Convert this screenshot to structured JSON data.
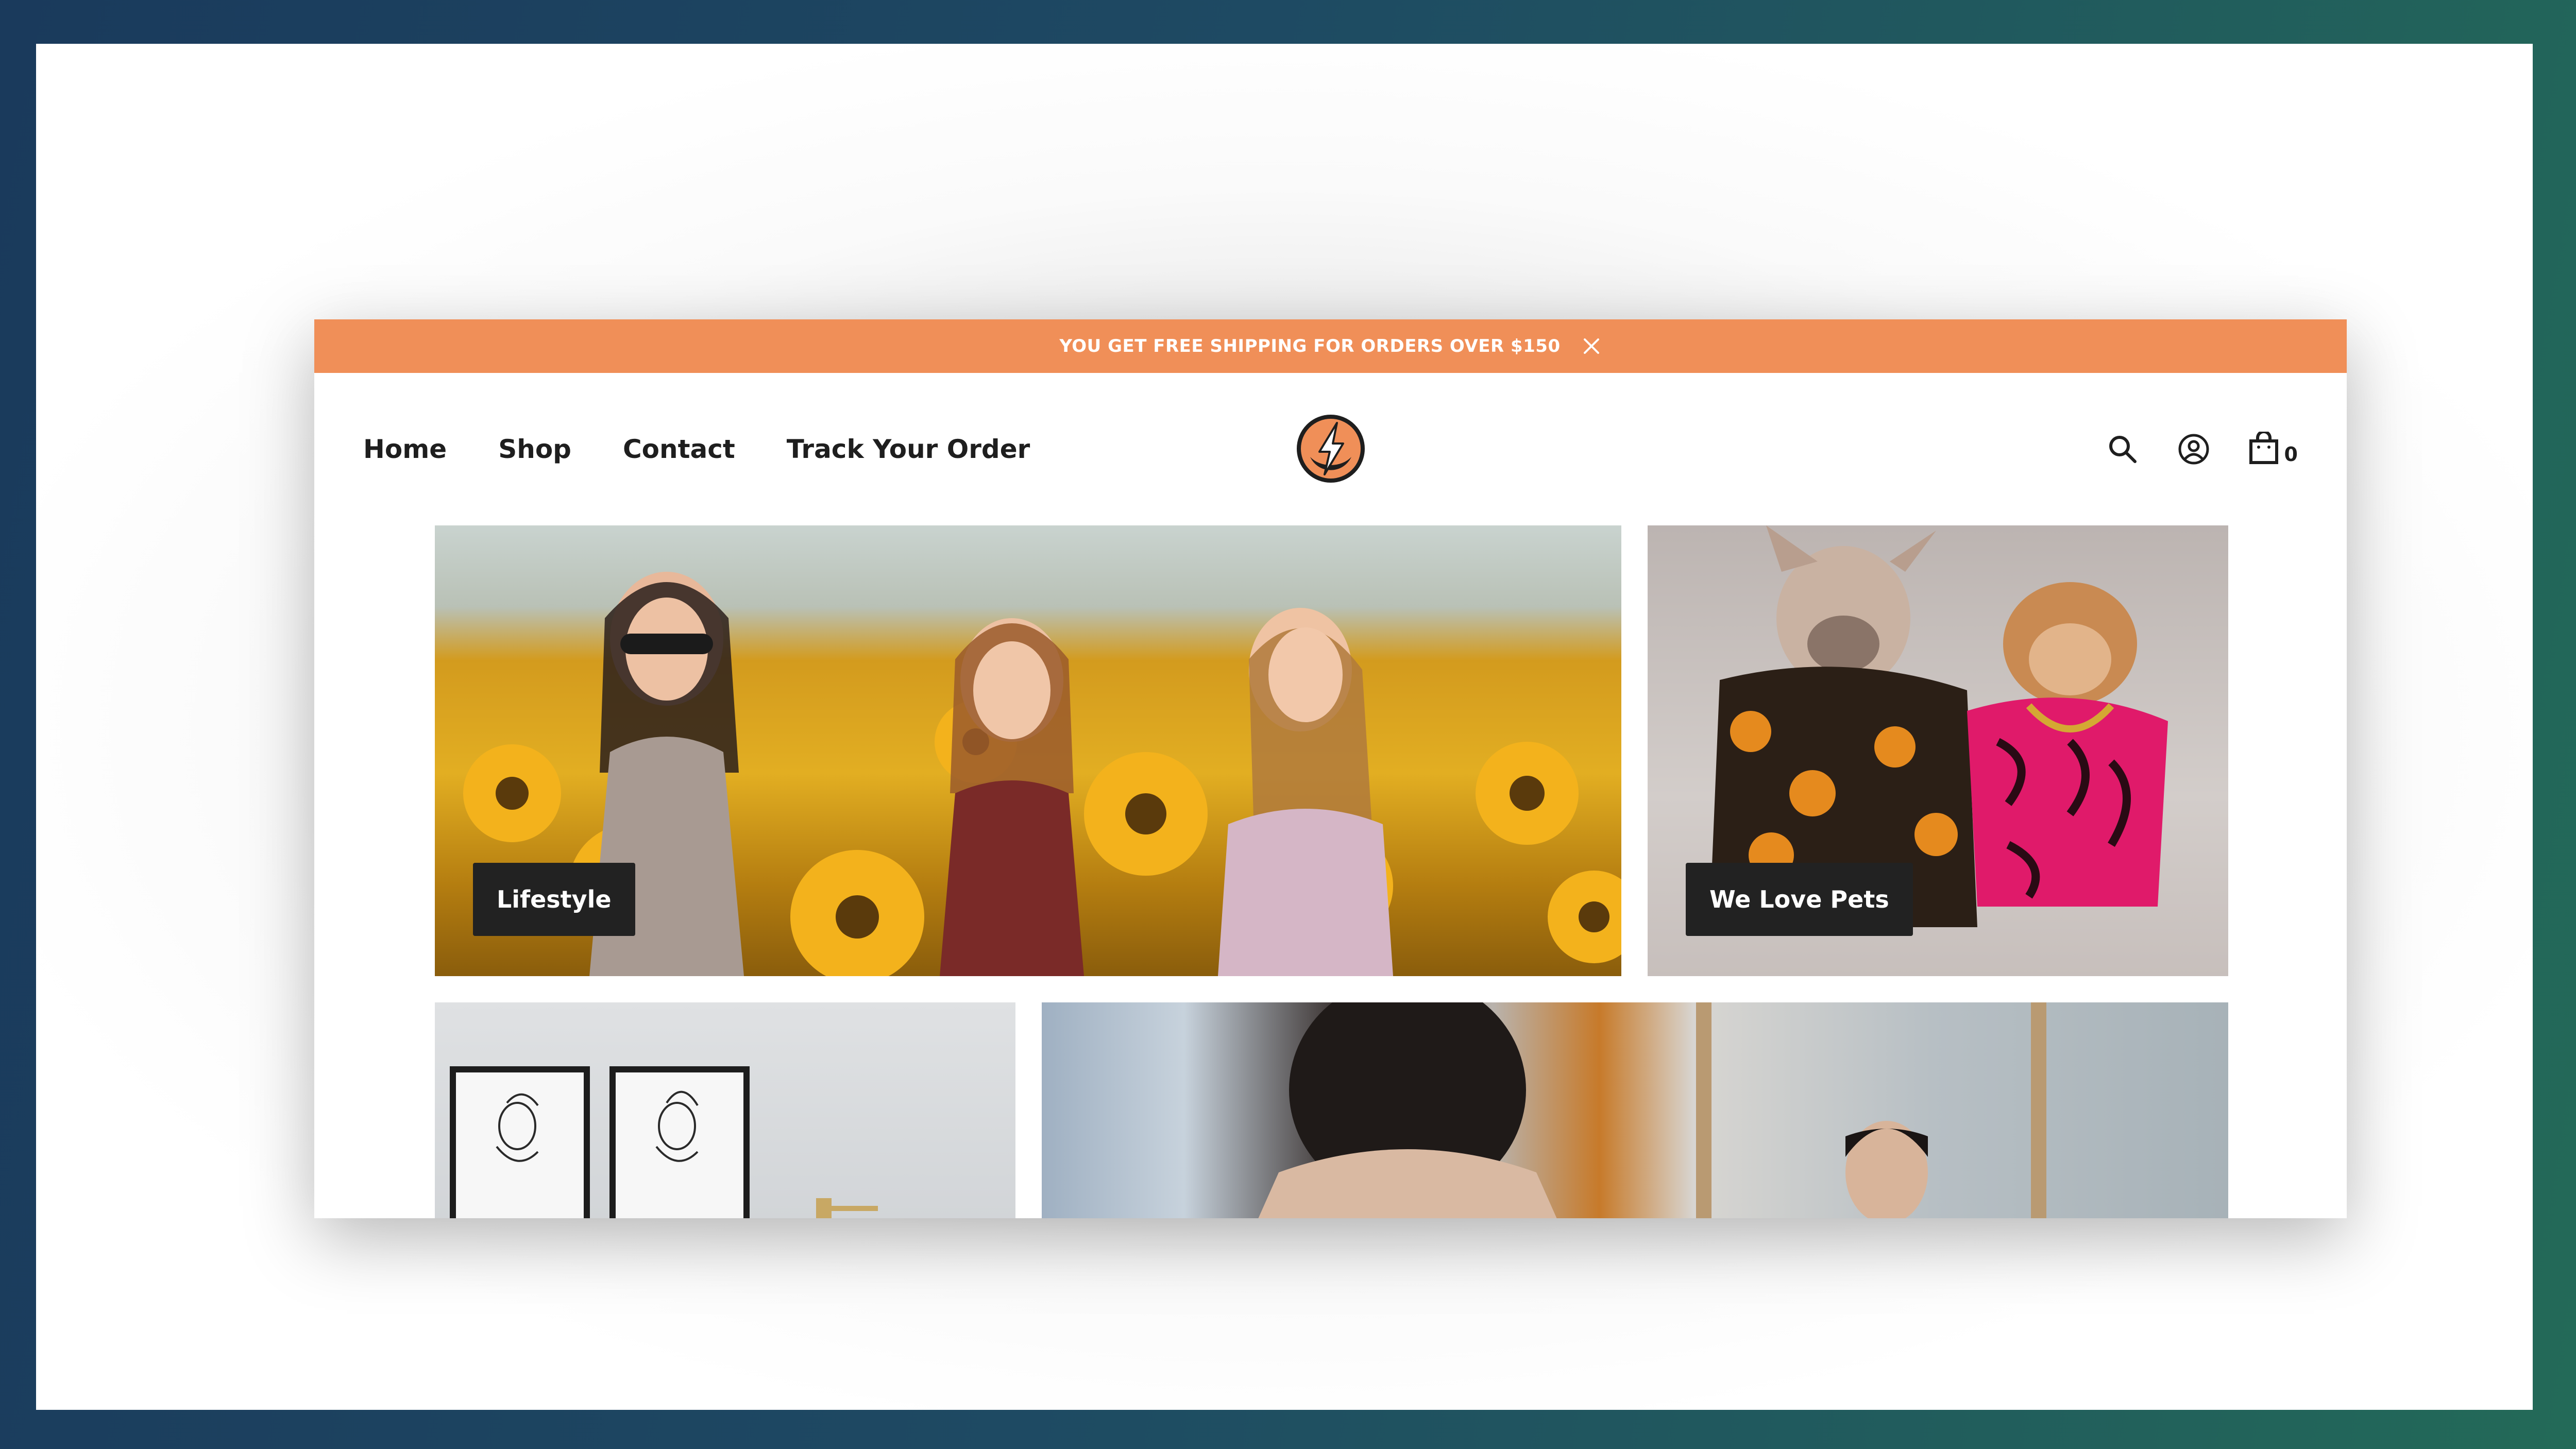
{
  "announcement": {
    "text": "YOU GET FREE SHIPPING FOR ORDERS OVER $150",
    "close_icon": "close-icon",
    "background": "#f08f58"
  },
  "nav": {
    "items": [
      {
        "label": "Home"
      },
      {
        "label": "Shop"
      },
      {
        "label": "Contact"
      },
      {
        "label": "Track Your Order"
      }
    ]
  },
  "header": {
    "logo_icon": "lightning-logo-icon",
    "accent": "#f08f58",
    "search_icon": "search-icon",
    "account_icon": "user-circle-icon",
    "cart_icon": "shopping-bag-icon",
    "cart_count": "0"
  },
  "collections": [
    {
      "label": "Lifestyle"
    },
    {
      "label": "We Love Pets"
    }
  ]
}
